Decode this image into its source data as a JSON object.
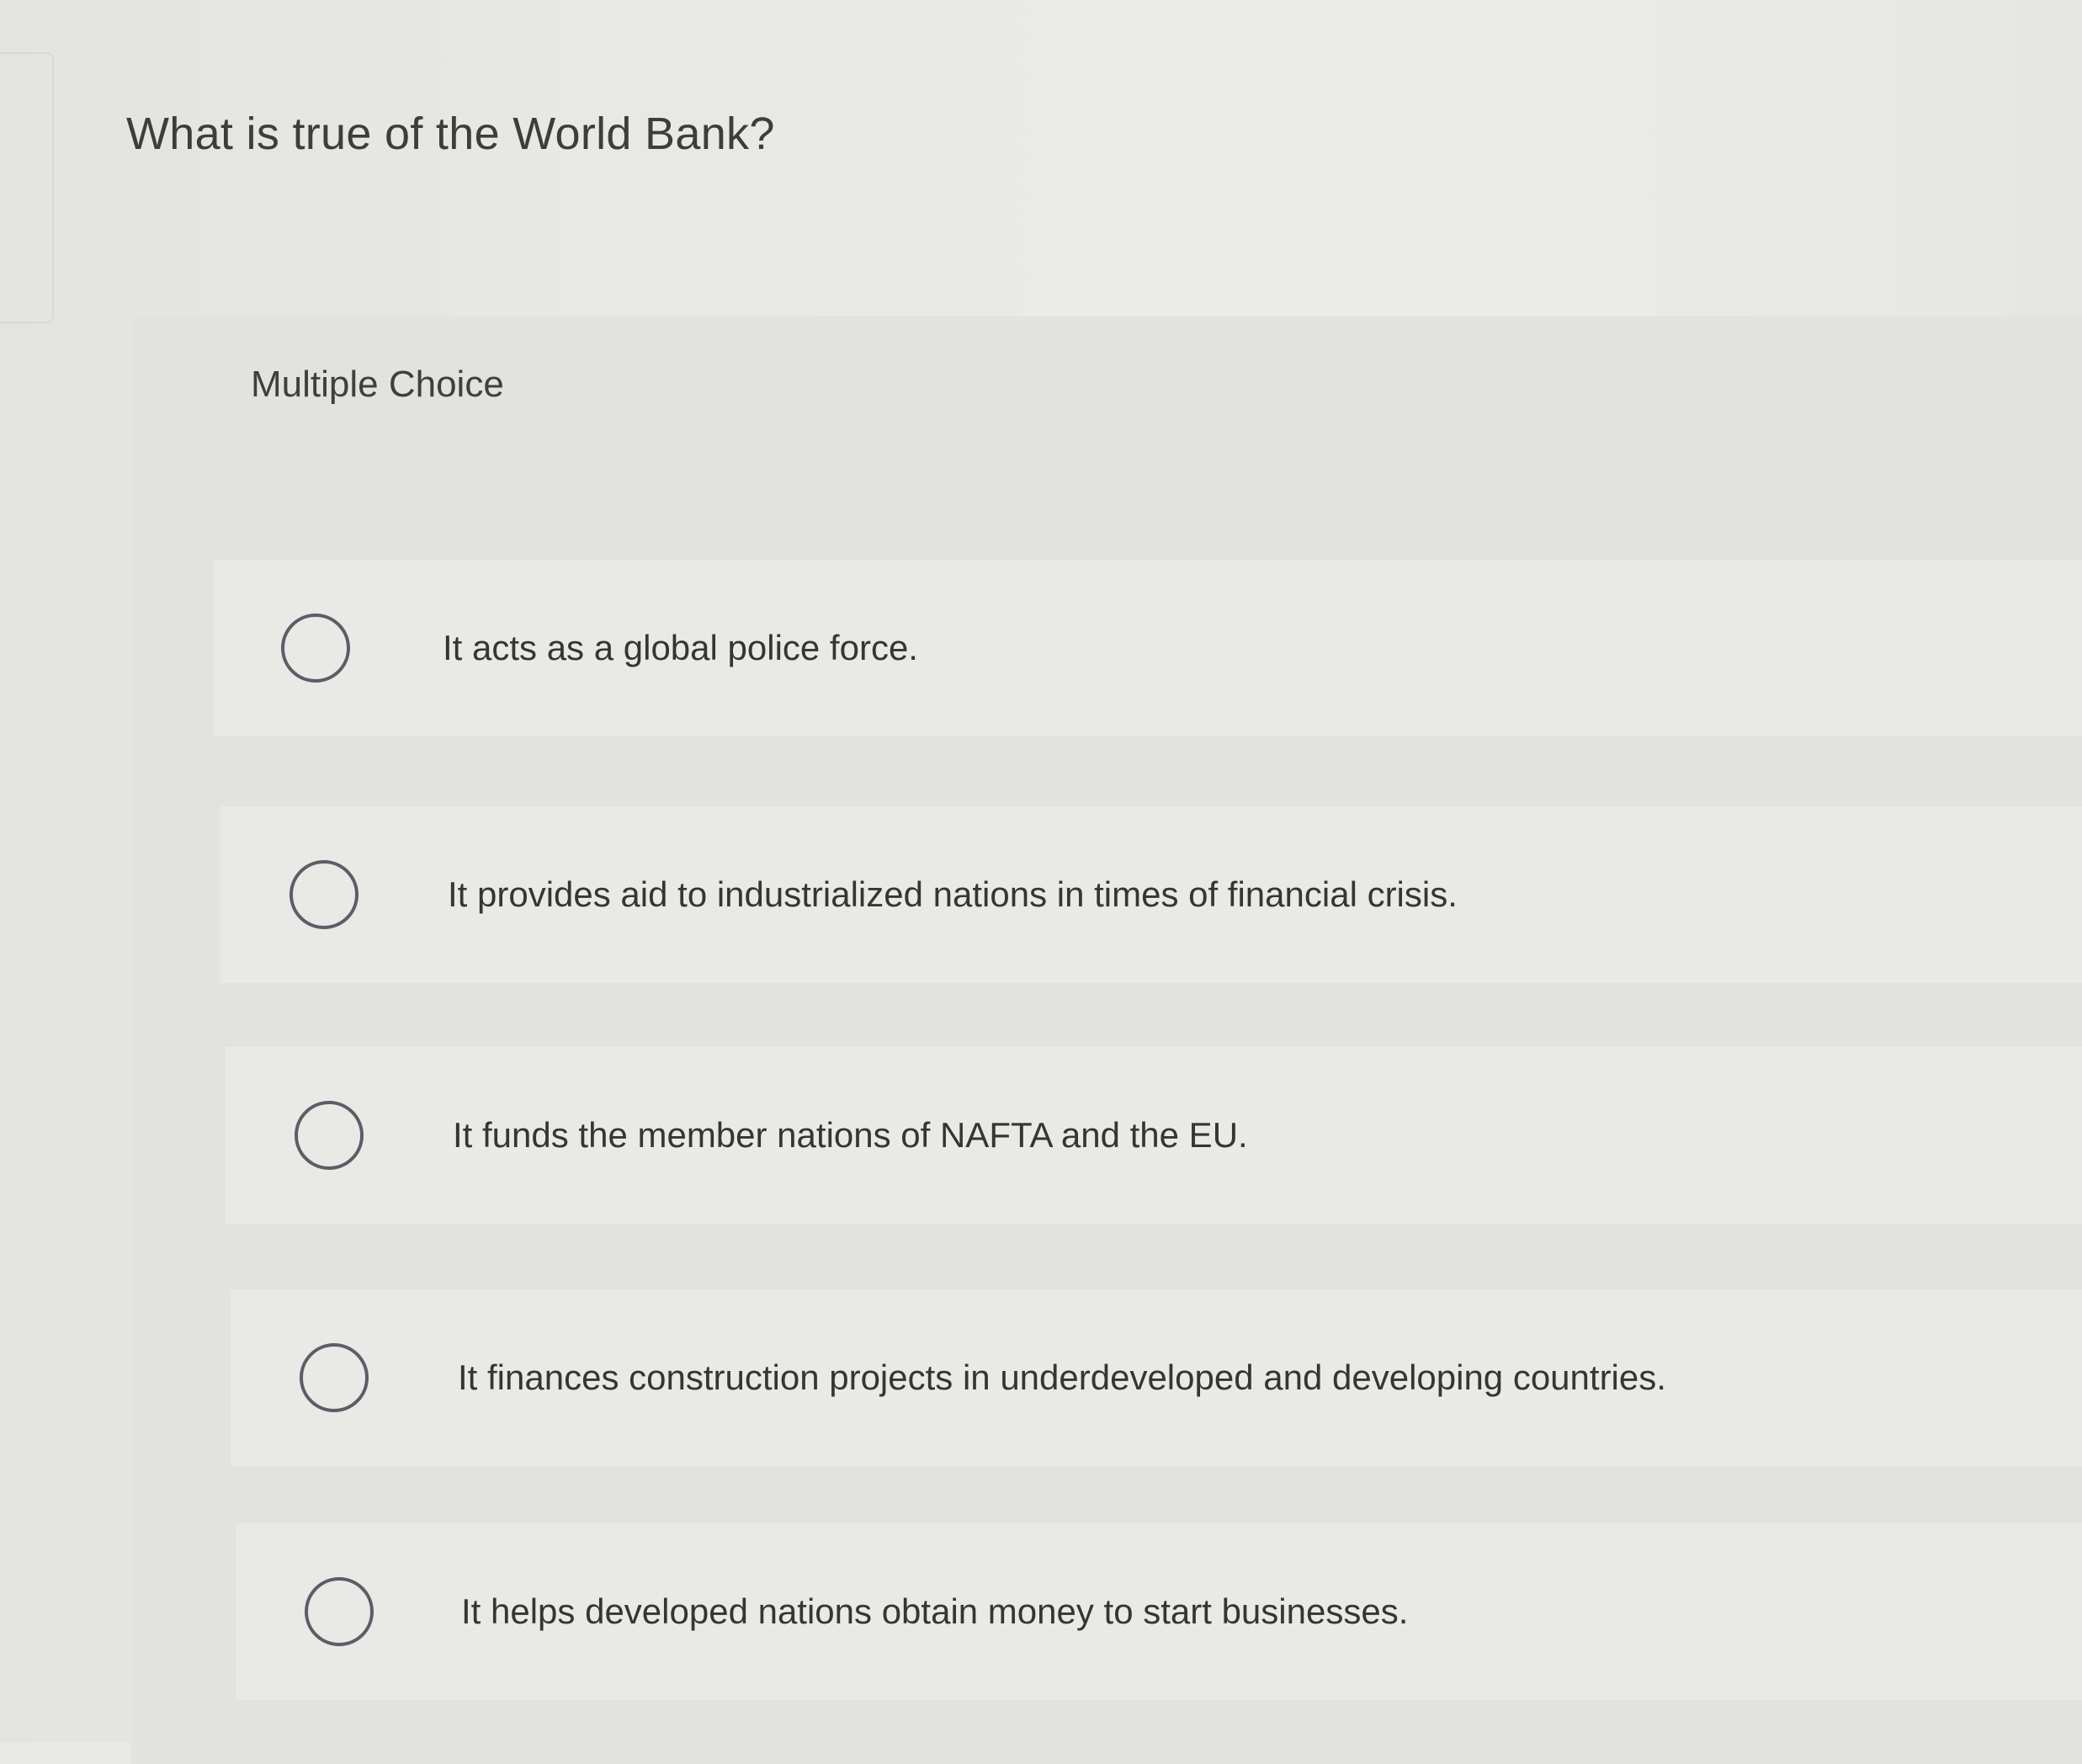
{
  "question": {
    "text": "What is true of the World Bank?"
  },
  "question_type": {
    "label": "Multiple Choice"
  },
  "options": [
    {
      "label": "It acts as a global police force.",
      "selected": false
    },
    {
      "label": "It provides aid to industrialized nations in times of financial crisis.",
      "selected": false
    },
    {
      "label": "It funds the member nations of NAFTA and the EU.",
      "selected": false
    },
    {
      "label": "It finances construction projects in underdeveloped and developing countries.",
      "selected": false
    },
    {
      "label": "It helps developed nations obtain money to start businesses.",
      "selected": false
    }
  ],
  "colors": {
    "background": "#e9e9e6",
    "panel": "#e2e2de",
    "text": "#353535",
    "radio_border": "#5a5e66"
  }
}
